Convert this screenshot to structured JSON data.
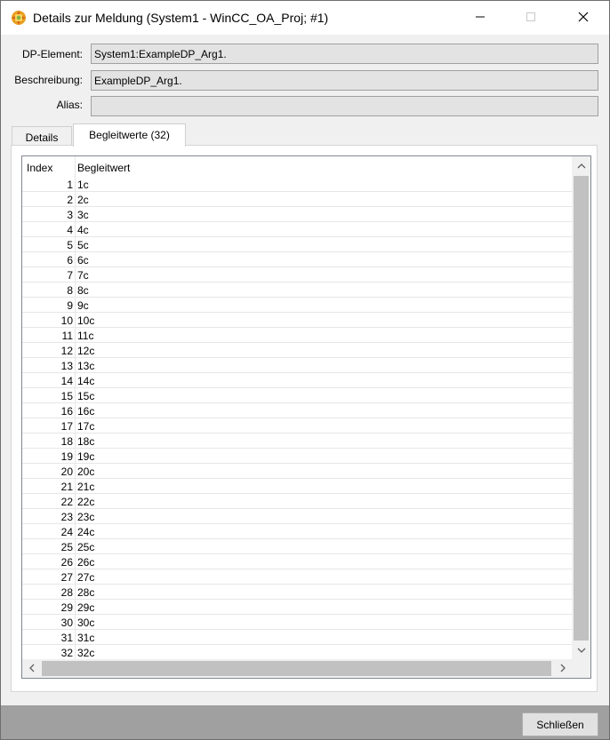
{
  "window": {
    "title": "Details zur Meldung  (System1 - WinCC_OA_Proj; #1)"
  },
  "fields": {
    "dp_element_label": "DP-Element:",
    "dp_element_value": "System1:ExampleDP_Arg1.",
    "description_label": "Beschreibung:",
    "description_value": "ExampleDP_Arg1.",
    "alias_label": "Alias:",
    "alias_value": ""
  },
  "tabs": [
    {
      "label": "Details",
      "active": false
    },
    {
      "label": "Begleitwerte (32)",
      "active": true
    }
  ],
  "table": {
    "headers": {
      "index": "Index",
      "value": "Begleitwert"
    },
    "rows": [
      {
        "index": "1",
        "value": "1c"
      },
      {
        "index": "2",
        "value": "2c"
      },
      {
        "index": "3",
        "value": "3c"
      },
      {
        "index": "4",
        "value": "4c"
      },
      {
        "index": "5",
        "value": "5c"
      },
      {
        "index": "6",
        "value": "6c"
      },
      {
        "index": "7",
        "value": "7c"
      },
      {
        "index": "8",
        "value": "8c"
      },
      {
        "index": "9",
        "value": "9c"
      },
      {
        "index": "10",
        "value": "10c"
      },
      {
        "index": "11",
        "value": "11c"
      },
      {
        "index": "12",
        "value": "12c"
      },
      {
        "index": "13",
        "value": "13c"
      },
      {
        "index": "14",
        "value": "14c"
      },
      {
        "index": "15",
        "value": "15c"
      },
      {
        "index": "16",
        "value": "16c"
      },
      {
        "index": "17",
        "value": "17c"
      },
      {
        "index": "18",
        "value": "18c"
      },
      {
        "index": "19",
        "value": "19c"
      },
      {
        "index": "20",
        "value": "20c"
      },
      {
        "index": "21",
        "value": "21c"
      },
      {
        "index": "22",
        "value": "22c"
      },
      {
        "index": "23",
        "value": "23c"
      },
      {
        "index": "24",
        "value": "24c"
      },
      {
        "index": "25",
        "value": "25c"
      },
      {
        "index": "26",
        "value": "26c"
      },
      {
        "index": "27",
        "value": "27c"
      },
      {
        "index": "28",
        "value": "28c"
      },
      {
        "index": "29",
        "value": "29c"
      },
      {
        "index": "30",
        "value": "30c"
      },
      {
        "index": "31",
        "value": "31c"
      },
      {
        "index": "32",
        "value": "32c"
      }
    ]
  },
  "footer": {
    "close_label": "Schließen"
  },
  "icons": {
    "app": "gear-flame-icon",
    "minimize": "minimize-icon",
    "maximize": "maximize-icon",
    "close": "close-icon",
    "scroll_up": "chevron-up-icon",
    "scroll_down": "chevron-down-icon",
    "scroll_left": "chevron-left-icon",
    "scroll_right": "chevron-right-icon"
  },
  "colors": {
    "footer_bar": "#a0a0a0",
    "field_background": "#e3e3e3",
    "scroll_thumb": "#c1c1c1"
  }
}
